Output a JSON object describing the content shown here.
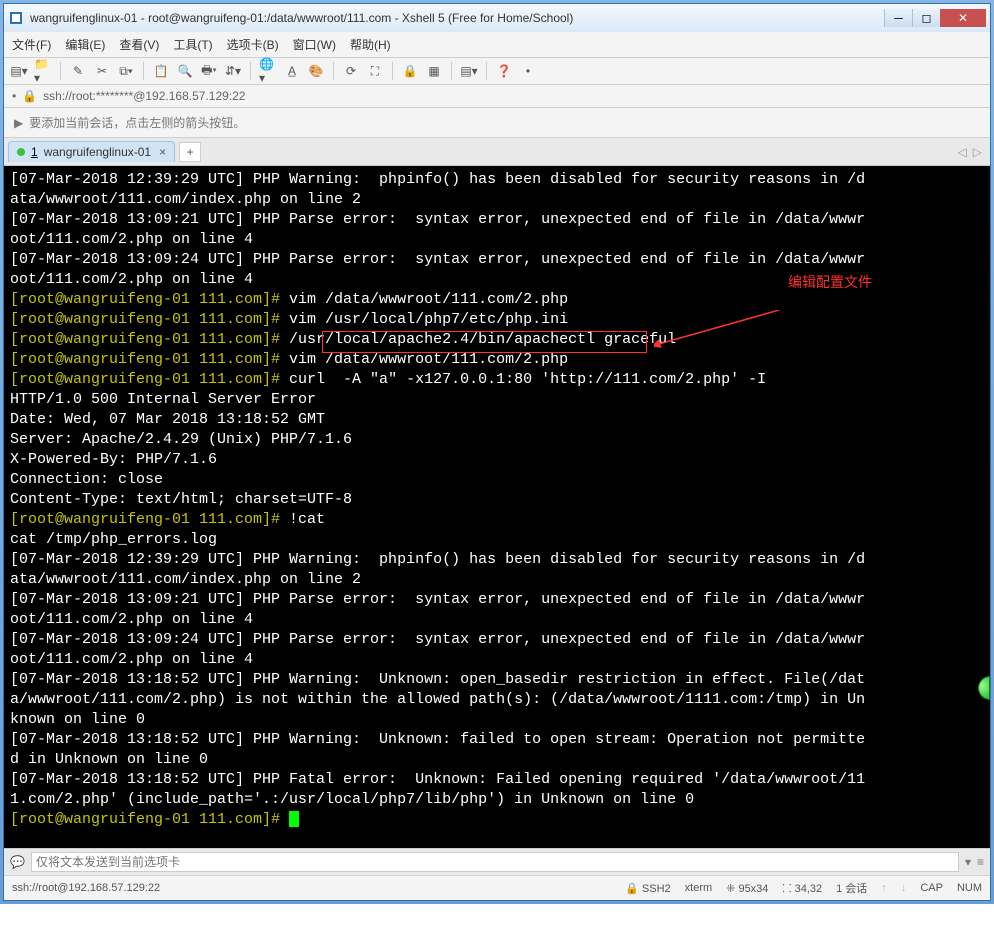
{
  "window": {
    "title": "wangruifenglinux-01 - root@wangruifeng-01:/data/wwwroot/111.com - Xshell 5 (Free for Home/School)"
  },
  "menu": {
    "file": "文件(F)",
    "edit": "编辑(E)",
    "view": "查看(V)",
    "tools": "工具(T)",
    "tabs": "选项卡(B)",
    "window": "窗口(W)",
    "help": "帮助(H)"
  },
  "address": {
    "lock_icon": "🔒",
    "text": "ssh://root:********@192.168.57.129:22"
  },
  "hint": {
    "icon": "▶",
    "text": "要添加当前会话，点击左侧的箭头按钮。"
  },
  "tab": {
    "index": "1",
    "name": "wangruifenglinux-01",
    "close": "×",
    "add": "+"
  },
  "annotation": "编辑配置文件",
  "terminal_lines": [
    {
      "segments": [
        {
          "t": "[07-Mar-2018 12:39:29 UTC] PHP Warning:  phpinfo() has been disabled for security reasons in /d"
        }
      ]
    },
    {
      "segments": [
        {
          "t": "ata/wwwroot/111.com/index.php on line 2"
        }
      ]
    },
    {
      "segments": [
        {
          "t": "[07-Mar-2018 13:09:21 UTC] PHP Parse error:  syntax error, unexpected end of file in /data/wwwr"
        }
      ]
    },
    {
      "segments": [
        {
          "t": "oot/111.com/2.php on line 4"
        }
      ]
    },
    {
      "segments": [
        {
          "t": "[07-Mar-2018 13:09:24 UTC] PHP Parse error:  syntax error, unexpected end of file in /data/wwwr"
        }
      ]
    },
    {
      "segments": [
        {
          "t": "oot/111.com/2.php on line 4"
        }
      ]
    },
    {
      "segments": [
        {
          "t": "[root@wangruifeng-01 111.com]# ",
          "c": "y"
        },
        {
          "t": "vim /data/wwwroot/111.com/2.php"
        }
      ]
    },
    {
      "segments": [
        {
          "t": "[root@wangruifeng-01 111.com]# ",
          "c": "y"
        },
        {
          "t": "vim /usr/local/php7/etc/php.ini"
        }
      ]
    },
    {
      "segments": [
        {
          "t": "[root@wangruifeng-01 111.com]# ",
          "c": "y"
        },
        {
          "t": "/usr/local/apache2.4/bin/apachectl graceful"
        }
      ]
    },
    {
      "segments": [
        {
          "t": "[root@wangruifeng-01 111.com]# ",
          "c": "y"
        },
        {
          "t": "vim /data/wwwroot/111.com/2.php"
        }
      ]
    },
    {
      "segments": [
        {
          "t": "[root@wangruifeng-01 111.com]# ",
          "c": "y"
        },
        {
          "t": "curl  -A \"a\" -x127.0.0.1:80 'http://111.com/2.php' -I"
        }
      ]
    },
    {
      "segments": [
        {
          "t": "HTTP/1.0 500 Internal Server Error"
        }
      ]
    },
    {
      "segments": [
        {
          "t": "Date: Wed, 07 Mar 2018 13:18:52 GMT"
        }
      ]
    },
    {
      "segments": [
        {
          "t": "Server: Apache/2.4.29 (Unix) PHP/7.1.6"
        }
      ]
    },
    {
      "segments": [
        {
          "t": "X-Powered-By: PHP/7.1.6"
        }
      ]
    },
    {
      "segments": [
        {
          "t": "Connection: close"
        }
      ]
    },
    {
      "segments": [
        {
          "t": "Content-Type: text/html; charset=UTF-8"
        }
      ]
    },
    {
      "segments": [
        {
          "t": ""
        }
      ]
    },
    {
      "segments": [
        {
          "t": "[root@wangruifeng-01 111.com]# ",
          "c": "y"
        },
        {
          "t": "!cat"
        }
      ]
    },
    {
      "segments": [
        {
          "t": "cat /tmp/php_errors.log"
        }
      ]
    },
    {
      "segments": [
        {
          "t": "[07-Mar-2018 12:39:29 UTC] PHP Warning:  phpinfo() has been disabled for security reasons in /d"
        }
      ]
    },
    {
      "segments": [
        {
          "t": "ata/wwwroot/111.com/index.php on line 2"
        }
      ]
    },
    {
      "segments": [
        {
          "t": "[07-Mar-2018 13:09:21 UTC] PHP Parse error:  syntax error, unexpected end of file in /data/wwwr"
        }
      ]
    },
    {
      "segments": [
        {
          "t": "oot/111.com/2.php on line 4"
        }
      ]
    },
    {
      "segments": [
        {
          "t": "[07-Mar-2018 13:09:24 UTC] PHP Parse error:  syntax error, unexpected end of file in /data/wwwr"
        }
      ]
    },
    {
      "segments": [
        {
          "t": "oot/111.com/2.php on line 4"
        }
      ]
    },
    {
      "segments": [
        {
          "t": "[07-Mar-2018 13:18:52 UTC] PHP Warning:  Unknown: open_basedir restriction in effect. File(/dat"
        }
      ]
    },
    {
      "segments": [
        {
          "t": "a/wwwroot/111.com/2.php) is not within the allowed path(s): (/data/wwwroot/1111.com:/tmp) in Un"
        }
      ]
    },
    {
      "segments": [
        {
          "t": "known on line 0"
        }
      ]
    },
    {
      "segments": [
        {
          "t": "[07-Mar-2018 13:18:52 UTC] PHP Warning:  Unknown: failed to open stream: Operation not permitte"
        }
      ]
    },
    {
      "segments": [
        {
          "t": "d in Unknown on line 0"
        }
      ]
    },
    {
      "segments": [
        {
          "t": "[07-Mar-2018 13:18:52 UTC] PHP Fatal error:  Unknown: Failed opening required '/data/wwwroot/11"
        }
      ]
    },
    {
      "segments": [
        {
          "t": "1.com/2.php' (include_path='.:/usr/local/php7/lib/php') in Unknown on line 0"
        }
      ]
    },
    {
      "segments": [
        {
          "t": "[root@wangruifeng-01 111.com]# ",
          "c": "y"
        }
      ],
      "cursor": true
    }
  ],
  "sendbar": {
    "icon": "💬",
    "placeholder": "仅将文本发送到当前选项卡"
  },
  "status": {
    "conn": "ssh://root@192.168.57.129:22",
    "ssh": "🔒 SSH2",
    "term": "xterm",
    "size": "⁜ 95x34",
    "pos": "⸬ 34,32",
    "sess": "1 会话",
    "cap": "CAP",
    "num": "NUM"
  },
  "toolbar_icons": [
    "new-session-icon",
    "open-icon",
    "reconnect-icon",
    "disconnect-icon",
    "properties-icon",
    "copy-icon",
    "paste-icon",
    "find-icon",
    "print-icon",
    "transfer-icon",
    "globe-icon",
    "font-icon",
    "color-icon",
    "script-icon",
    "fullscreen-icon",
    "lock-icon",
    "layout-icon",
    "grid-icon",
    "help-icon"
  ]
}
